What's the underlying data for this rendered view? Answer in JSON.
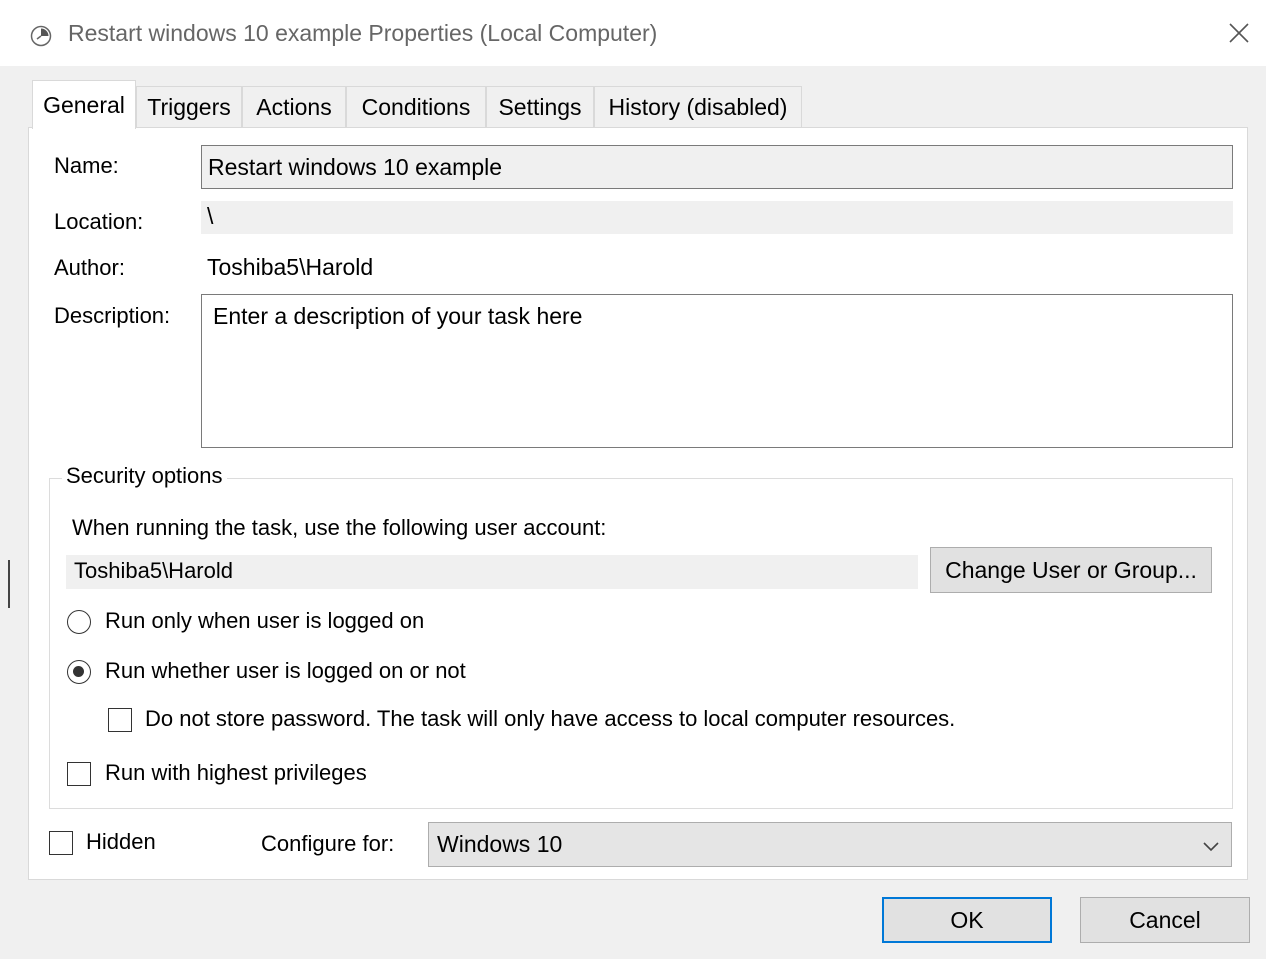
{
  "window": {
    "title": "Restart windows 10 example Properties (Local Computer)",
    "title_icon": "clock-icon",
    "close_icon": "close-icon"
  },
  "tabs": [
    {
      "label": "General",
      "active": true
    },
    {
      "label": "Triggers",
      "active": false
    },
    {
      "label": "Actions",
      "active": false
    },
    {
      "label": "Conditions",
      "active": false
    },
    {
      "label": "Settings",
      "active": false
    },
    {
      "label": "History (disabled)",
      "active": false
    }
  ],
  "general": {
    "name_label": "Name:",
    "name_value": "Restart windows 10 example",
    "location_label": "Location:",
    "location_value": "\\",
    "author_label": "Author:",
    "author_value": "Toshiba5\\Harold",
    "description_label": "Description:",
    "description_value": "Enter a description of your task here"
  },
  "security": {
    "legend": "Security options",
    "account_prompt": "When running the task, use the following user account:",
    "account_value": "Toshiba5\\Harold",
    "change_button": "Change User or Group...",
    "radio_logged_on": {
      "label": "Run only when user is logged on",
      "checked": false
    },
    "radio_whether": {
      "label": "Run whether user is logged on or not",
      "checked": true
    },
    "no_store_password": {
      "label": "Do not store password.  The task will only have access to local computer resources.",
      "checked": false
    },
    "highest_privileges": {
      "label": "Run with highest privileges",
      "checked": false
    }
  },
  "footer": {
    "hidden": {
      "label": "Hidden",
      "checked": false
    },
    "configure_label": "Configure for:",
    "configure_value": "Windows 10"
  },
  "buttons": {
    "ok": "OK",
    "cancel": "Cancel"
  },
  "colors": {
    "focus_border": "#0078d7",
    "dialog_bg": "#f0f0f0"
  }
}
